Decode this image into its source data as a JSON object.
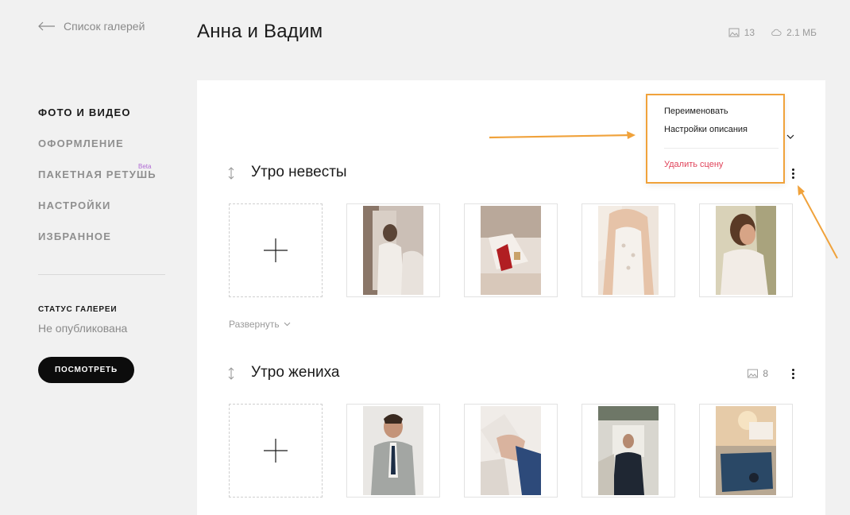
{
  "back_link": {
    "label": "Список галерей"
  },
  "header": {
    "title": "Анна и Вадим",
    "photo_count": "13",
    "storage": "2.1 МБ"
  },
  "sidebar": {
    "items": [
      {
        "label": "ФОТО И ВИДЕО",
        "active": true
      },
      {
        "label": "ОФОРМЛЕНИЕ",
        "active": false
      },
      {
        "label": "ПАКЕТНАЯ РЕТУШЬ",
        "active": false,
        "badge": "Beta"
      },
      {
        "label": "НАСТРОЙКИ",
        "active": false
      },
      {
        "label": "ИЗБРАННОЕ",
        "active": false
      }
    ],
    "status_label": "СТАТУС ГАЛЕРЕИ",
    "status_value": "Не опубликована",
    "view_button": "ПОСМОТРЕТЬ"
  },
  "scenes": [
    {
      "title": "Утро невесты",
      "expand_label": "Развернуть",
      "count": ""
    },
    {
      "title": "Утро жениха",
      "count": "8"
    }
  ],
  "dropdown": {
    "items": [
      "Переименовать",
      "Настройки описания"
    ],
    "danger_item": "Удалить сцену"
  },
  "colors": {
    "accent_annotation": "#f0a23b",
    "danger": "#e0435a",
    "beta": "#b06ad4",
    "primary_button": "#0c0c0c"
  }
}
